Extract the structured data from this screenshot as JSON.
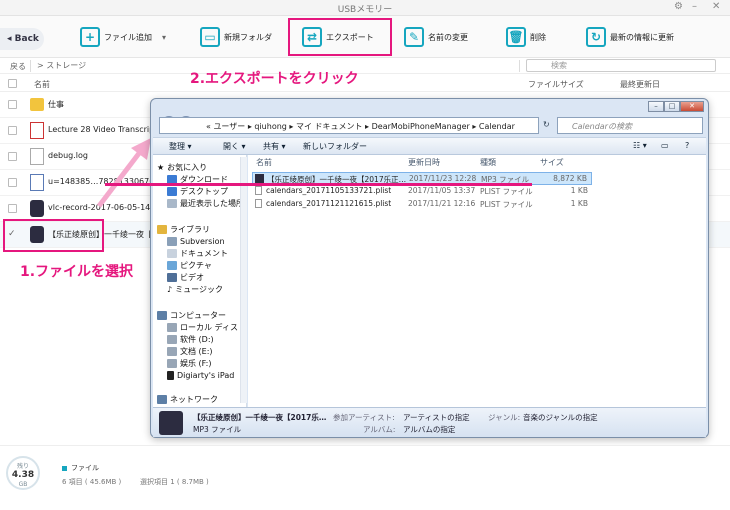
{
  "window": {
    "title": "USBメモリー",
    "close": "✕",
    "settings": "⚙"
  },
  "toolbar": {
    "back": "Back",
    "items": [
      "ファイル追加",
      "新規フォルダ",
      "エクスポート",
      "名前の変更",
      "削除",
      "最新の情報に更新"
    ]
  },
  "address": {
    "back": "戻る",
    "path": "> ストレージ",
    "search_placeholder": "検索"
  },
  "columns": {
    "name": "名前",
    "size": "ファイルサイズ",
    "modified": "最終更新日"
  },
  "rows": [
    "仕事",
    "Lecture 28 Video Transcript The",
    "debug.log",
    "u=148385…782813306765&f",
    "vlc-record-2017-06-05-14h05m",
    "【乐正绫原创】一千绫一夜【2017"
  ],
  "annotations": {
    "step1": "1.ファイルを選択",
    "step2": "2.エクスポートをクリック"
  },
  "explorer": {
    "address": "« ユーザー ▸ qiuhong ▸ マイ ドキュメント ▸ DearMobiPhoneManager ▸ Calendar",
    "search_placeholder": "Calendarの検索",
    "commands": [
      "整理 ▾",
      "開く ▾",
      "共有 ▾",
      "新しいフォルダー"
    ],
    "nav": [
      "お気に入り",
      "ダウンロード",
      "デスクトップ",
      "最近表示した場所",
      "ライブラリ",
      "Subversion",
      "ドキュメント",
      "ピクチャ",
      "ビデオ",
      "ミュージック",
      "コンピューター",
      "ローカル ディス",
      "软件 (D:)",
      "文档 (E:)",
      "娱乐 (F:)",
      "Digiarty's iPad",
      "ネットワーク"
    ],
    "headers": {
      "name": "名前",
      "date": "更新日時",
      "type": "種類",
      "size": "サイズ"
    },
    "files": [
      {
        "name": "【乐正绫原创】一千绫一夜【2017乐正…",
        "date": "2017/11/23 12:28",
        "type": "MP3 ファイル",
        "size": "8,872 KB"
      },
      {
        "name": "calendars_20171105133721.plist",
        "date": "2017/11/05 13:37",
        "type": "PLIST ファイル",
        "size": "1 KB"
      },
      {
        "name": "calendars_20171121121615.plist",
        "date": "2017/11/21 12:16",
        "type": "PLIST ファイル",
        "size": "1 KB"
      }
    ],
    "details": {
      "title": "【乐正绫原创】一千绫一夜【2017乐…",
      "type": "MP3 ファイル",
      "artist_label": "参加アーティスト:",
      "artist": "アーティストの指定",
      "album_label": "アルバム:",
      "album": "アルバムの指定",
      "genre_label": "ジャンル:",
      "genre": "音楽のジャンルの指定"
    }
  },
  "status": {
    "disk_label": "残り",
    "disk_value": "4.38",
    "disk_unit": "GB",
    "file_label": "ファイル",
    "items": "6 項目 ( 45.6MB )",
    "selected": "選択項目 1 ( 8.7MB )"
  },
  "colors": {
    "accent": "#16a6bf",
    "highlight": "#e5177e"
  }
}
